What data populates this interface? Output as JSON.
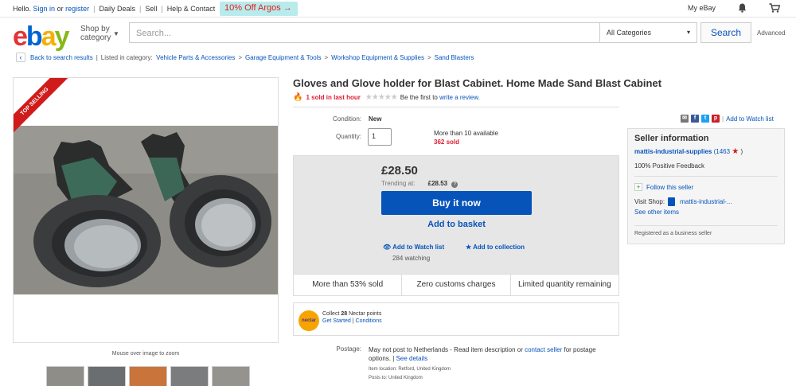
{
  "topbar": {
    "hello": "Hello.",
    "sign_in": "Sign in",
    "or": "or",
    "register": "register",
    "daily_deals": "Daily Deals",
    "sell": "Sell",
    "help": "Help & Contact",
    "promo": "10% Off Argos →",
    "my_ebay": "My eBay"
  },
  "header": {
    "shop_by_1": "Shop by",
    "shop_by_2": "category",
    "search_placeholder": "Search...",
    "category": "All Categories",
    "search_button": "Search",
    "advanced": "Advanced"
  },
  "breadcrumb": {
    "back": "Back to search results",
    "listed_in": "Listed in category:",
    "items": [
      "Vehicle Parts & Accessories",
      "Garage Equipment & Tools",
      "Workshop Equipment & Supplies",
      "Sand Blasters"
    ]
  },
  "image": {
    "ribbon": "TOP SELLING",
    "zoom_hint": "Mouse over image to zoom"
  },
  "listing": {
    "title": "Gloves and Glove holder for Blast Cabinet. Home Made Sand Blast Cabinet",
    "sold_last_hour": "1 sold in last hour",
    "be_first": "Be the first to",
    "write_review": "write a review.",
    "condition_label": "Condition:",
    "condition_value": "New",
    "quantity_label": "Quantity:",
    "quantity_value": "1",
    "available": "More than 10 available",
    "sold": "362 sold",
    "price": "£28.50",
    "trending_label": "Trending at:",
    "trending_value": "£28.53",
    "buy_now": "Buy it now",
    "add_basket": "Add to basket",
    "add_watch": "Add to Watch list",
    "watching": "284 watching",
    "add_collection": "Add to collection",
    "features": [
      "More than 53% sold",
      "Zero customs charges",
      "Limited quantity remaining"
    ],
    "nectar_collect": "Collect",
    "nectar_points": "28",
    "nectar_suffix": "Nectar points",
    "nectar_logo": "nectar",
    "get_started": "Get Started",
    "conditions": "Conditions",
    "postage_label": "Postage:",
    "postage_text": "May not post to Netherlands - Read item description or",
    "contact_seller": "contact seller",
    "postage_text2": "for postage options.",
    "see_details": "See details",
    "item_location": "Item location:  Retford, United Kingdom",
    "posts_to": "Posts to:  United Kingdom"
  },
  "sidebar": {
    "watch_list": "Add to Watch list",
    "seller_info": "Seller information",
    "seller_name": "mattis-industrial-supplies",
    "seller_score": "(1463",
    "seller_close": ")",
    "positive": "100% Positive Feedback",
    "follow": "Follow this seller",
    "visit_shop": "Visit Shop:",
    "shop_name": "mattis-industrial-...",
    "see_other": "See other items",
    "registered": "Registered as a business seller"
  },
  "colors": {
    "ebay_red": "#e53238",
    "ebay_blue": "#0064d2",
    "ebay_yellow": "#f5af02",
    "ebay_green": "#86b817",
    "link_blue": "#0654ba",
    "sold_red": "#dd1e31"
  }
}
